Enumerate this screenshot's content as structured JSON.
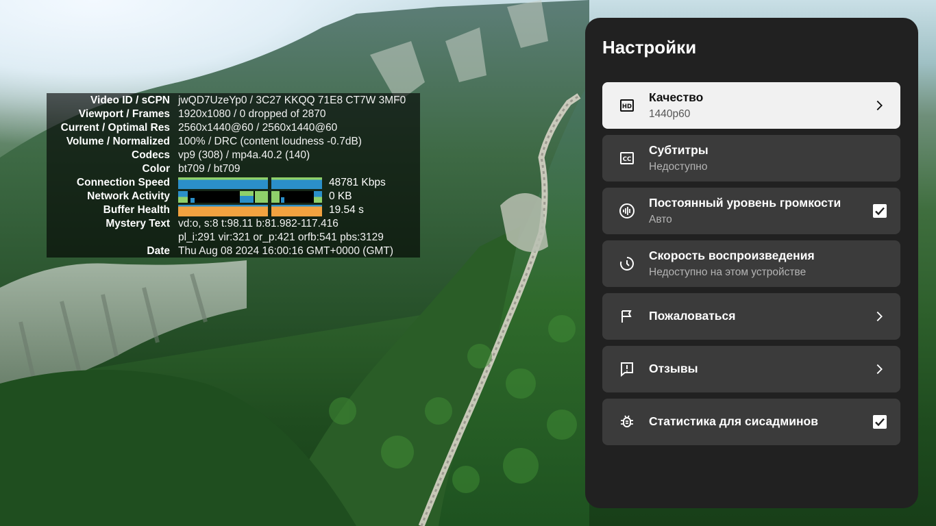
{
  "stats": {
    "rows": [
      {
        "label": "Video ID / sCPN",
        "value": "jwQD7UzeYp0 / 3C27 KKQQ 71E8 CT7W 3MF0"
      },
      {
        "label": "Viewport / Frames",
        "value": "1920x1080 / 0 dropped of 2870"
      },
      {
        "label": "Current / Optimal Res",
        "value": "2560x1440@60 / 2560x1440@60"
      },
      {
        "label": "Volume / Normalized",
        "value": "100% / DRC (content loudness -0.7dB)"
      },
      {
        "label": "Codecs",
        "value": "vp9 (308) / mp4a.40.2 (140)"
      },
      {
        "label": "Color",
        "value": "bt709 / bt709"
      }
    ],
    "connection_speed": {
      "label": "Connection Speed",
      "value": "48781 Kbps"
    },
    "network_activity": {
      "label": "Network Activity",
      "value": "0 KB"
    },
    "buffer_health": {
      "label": "Buffer Health",
      "value": "19.54 s"
    },
    "mystery_text": {
      "label": "Mystery Text",
      "line1": "vd:o, s:8 t:98.11 b:81.982-117.416",
      "line2": "pl_i:291 vir:321 or_p:421 orfb:541 pbs:3129"
    },
    "date": {
      "label": "Date",
      "value": "Thu Aug 08 2024 16:00:16 GMT+0000 (GMT)"
    }
  },
  "settings": {
    "title": "Настройки",
    "items": [
      {
        "icon": "hd-icon",
        "title": "Качество",
        "subtitle": "1440p60",
        "control": "chevron",
        "selected": true
      },
      {
        "icon": "closed-captions-icon",
        "title": "Субтитры",
        "subtitle": "Недоступно",
        "control": "none",
        "selected": false
      },
      {
        "icon": "volume-level-icon",
        "title": "Постоянный уровень громкости",
        "subtitle": "Авто",
        "control": "checkbox",
        "checked": true
      },
      {
        "icon": "playback-speed-icon",
        "title": "Скорость воспроизведения",
        "subtitle": "Недоступно на этом устройстве",
        "control": "none"
      },
      {
        "icon": "flag-icon",
        "title": "Пожаловаться",
        "subtitle": "",
        "control": "chevron"
      },
      {
        "icon": "feedback-icon",
        "title": "Отзывы",
        "subtitle": "",
        "control": "chevron"
      },
      {
        "icon": "bug-icon",
        "title": "Статистика для сисадминов",
        "subtitle": "",
        "control": "checkbox",
        "checked": true
      }
    ]
  },
  "colors": {
    "panel_bg": "#212121",
    "item_bg": "#3b3b3b",
    "selected_bg": "#f1f1f1",
    "graph_blue": "#2b8fc9",
    "graph_green": "#8fd06a",
    "graph_orange": "#f2a240"
  }
}
